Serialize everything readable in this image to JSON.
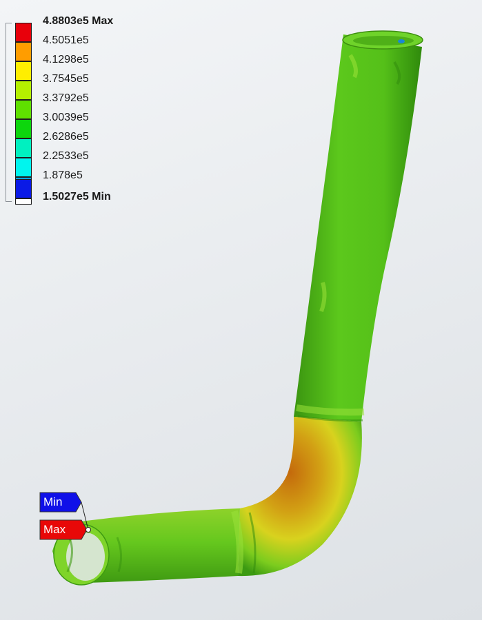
{
  "legend": {
    "items": [
      {
        "label": "4.8803e5 Max",
        "color": "#e8000b",
        "bold": true
      },
      {
        "label": "4.5051e5",
        "color": "#ff9d00",
        "bold": false
      },
      {
        "label": "4.1298e5",
        "color": "#ffee00",
        "bold": false
      },
      {
        "label": "3.7545e5",
        "color": "#b4f000",
        "bold": false
      },
      {
        "label": "3.3792e5",
        "color": "#5fe000",
        "bold": false
      },
      {
        "label": "3.0039e5",
        "color": "#0dd60d",
        "bold": false
      },
      {
        "label": "2.6286e5",
        "color": "#00f0c0",
        "bold": false
      },
      {
        "label": "2.2533e5",
        "color": "#00f5ee",
        "bold": false
      },
      {
        "label": "1.878e5",
        "color": "#00a8f0",
        "bold": false
      },
      {
        "label": "1.5027e5 Min",
        "color": "#0a1ae6",
        "bold": true
      }
    ]
  },
  "probes": {
    "min": {
      "label": "Min",
      "color": "#1010e8"
    },
    "max": {
      "label": "Max",
      "color": "#e80808"
    }
  },
  "model": {
    "colors": {
      "base_green": "#55c81a",
      "shadow_green": "#2f8a0c",
      "highlight": "#9ae82a",
      "bend_orange": "#d08a10",
      "bend_yellow": "#e8d21a"
    }
  }
}
